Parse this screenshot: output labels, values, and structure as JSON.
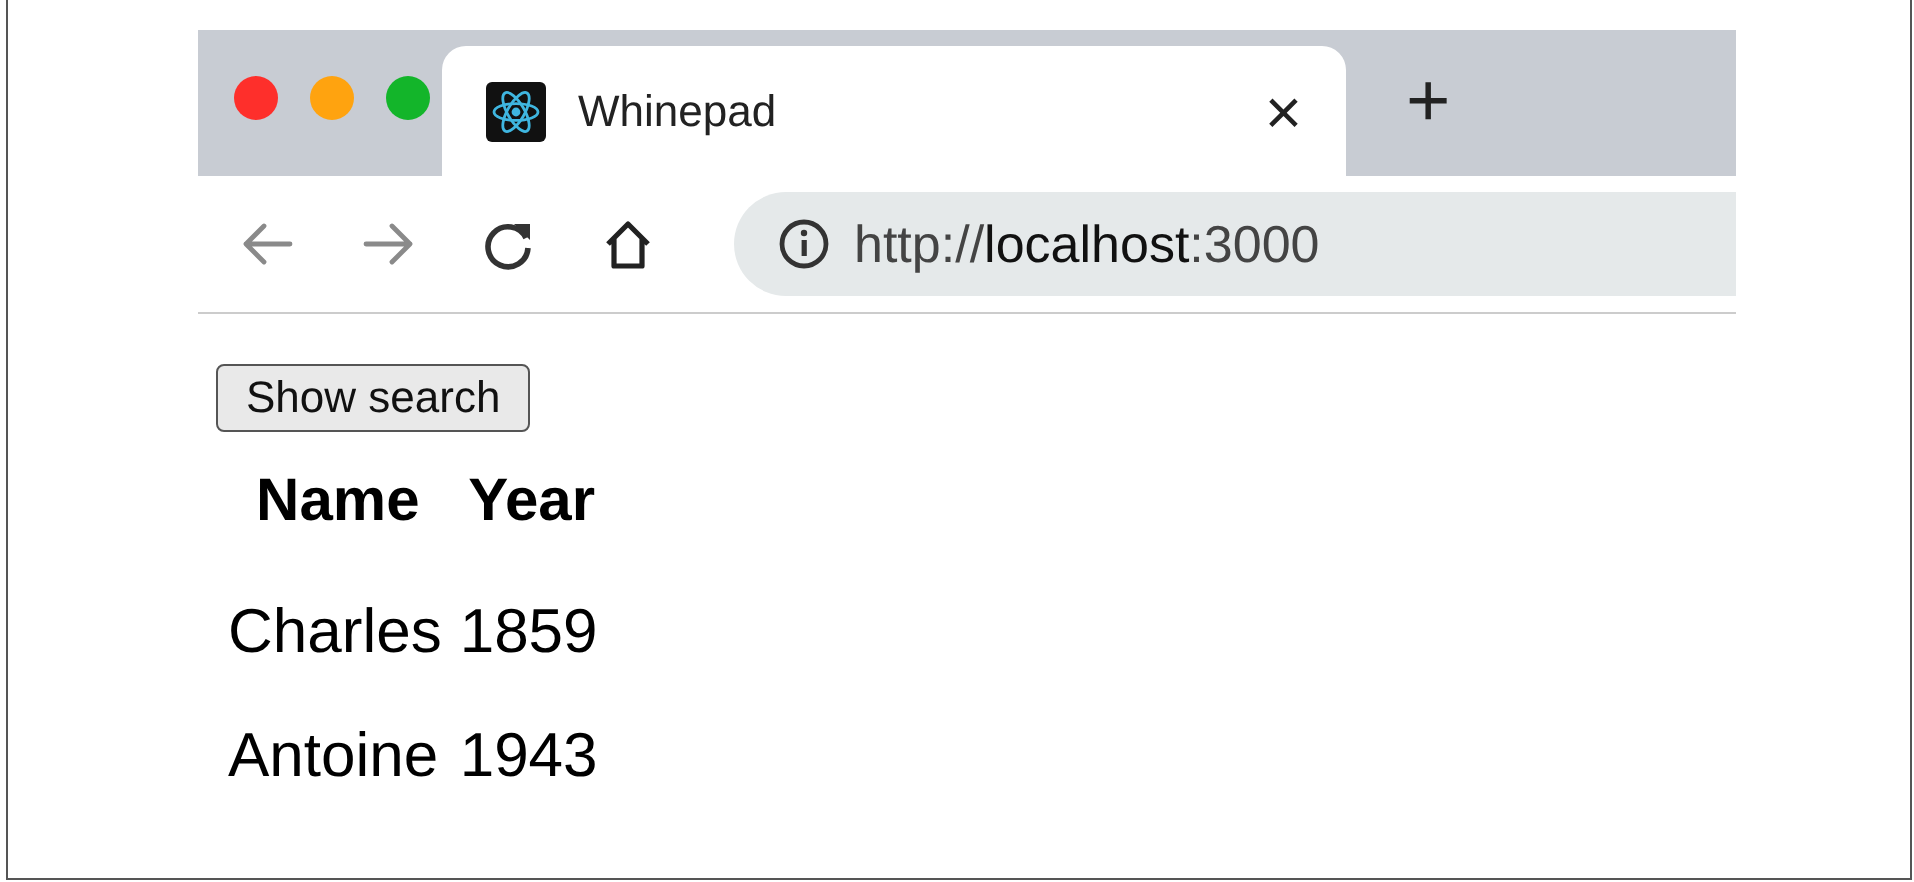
{
  "window": {
    "controls": [
      {
        "color": "#fe2f2b"
      },
      {
        "color": "#ffa30f"
      },
      {
        "color": "#13b52a"
      }
    ]
  },
  "tabs": [
    {
      "title": "Whinepad",
      "selected": true,
      "close": "×"
    }
  ],
  "new_tab": "+",
  "address": {
    "prefix": "http://",
    "host": "localhost",
    "suffix": ":3000"
  },
  "page": {
    "button": "Show search",
    "table": {
      "columns": [
        "Name",
        "Year"
      ],
      "rows": [
        [
          "Charles",
          "1859"
        ],
        [
          "Antoine",
          "1943"
        ]
      ]
    }
  }
}
